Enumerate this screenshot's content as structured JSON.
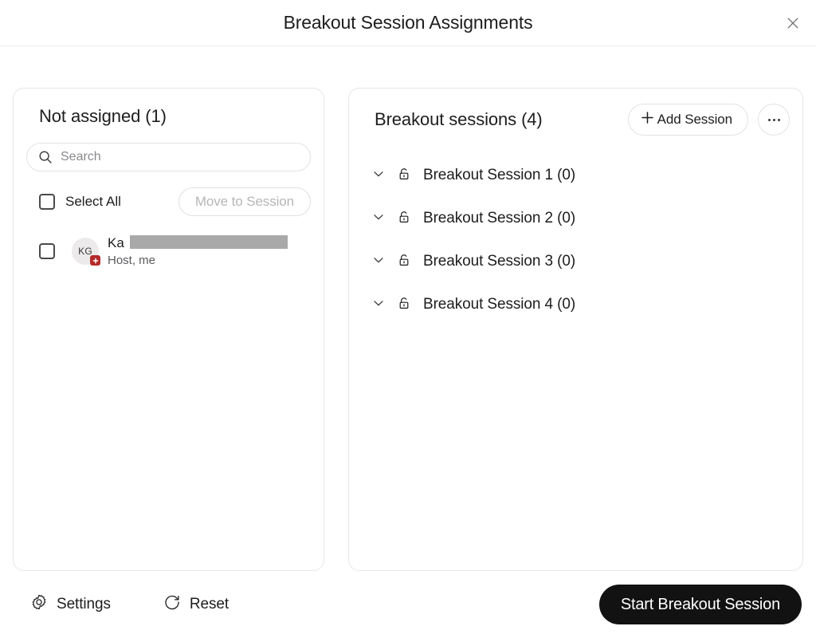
{
  "header": {
    "title": "Breakout Session Assignments",
    "close_icon": "close-icon"
  },
  "not_assigned": {
    "title": "Not assigned (1)",
    "search": {
      "placeholder": "Search",
      "value": "",
      "icon": "search-icon"
    },
    "select_all_label": "Select All",
    "move_to_session_label": "Move to Session",
    "move_to_session_disabled": true,
    "participants": [
      {
        "initials": "KG",
        "name_visible": "Ka",
        "name_redacted": true,
        "subtitle": "Host, me",
        "badge_icon": "plus-badge-icon",
        "checked": false
      }
    ]
  },
  "breakout_sessions": {
    "title": "Breakout sessions (4)",
    "add_session_label": "Add Session",
    "add_session_icon": "plus-icon",
    "more_options_icon": "ellipsis-icon",
    "sessions": [
      {
        "label": "Breakout Session 1 (0)",
        "expanded": false,
        "locked": false,
        "chevron_icon": "chevron-down-icon",
        "lock_icon": "unlock-icon"
      },
      {
        "label": "Breakout Session 2 (0)",
        "expanded": false,
        "locked": false,
        "chevron_icon": "chevron-down-icon",
        "lock_icon": "unlock-icon"
      },
      {
        "label": "Breakout Session 3 (0)",
        "expanded": false,
        "locked": false,
        "chevron_icon": "chevron-down-icon",
        "lock_icon": "unlock-icon"
      },
      {
        "label": "Breakout Session 4 (0)",
        "expanded": false,
        "locked": false,
        "chevron_icon": "chevron-down-icon",
        "lock_icon": "unlock-icon"
      }
    ]
  },
  "footer": {
    "settings_label": "Settings",
    "settings_icon": "gear-icon",
    "reset_label": "Reset",
    "reset_icon": "refresh-icon",
    "start_label": "Start Breakout Session"
  },
  "colors": {
    "accent_button_bg": "#121212",
    "accent_button_text": "#ffffff",
    "panel_border": "#e6e6e8",
    "text_primary": "#1d1d1f",
    "text_secondary": "#5a5a5e",
    "text_disabled": "#b6b6b9",
    "badge_red": "#b42a2a",
    "avatar_bg": "#eceaea",
    "redaction_gray": "#a9a9a9"
  }
}
